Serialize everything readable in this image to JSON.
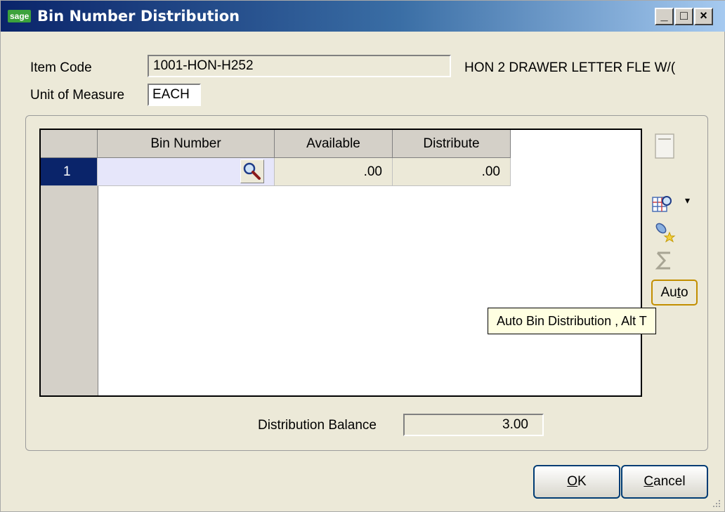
{
  "window": {
    "logo_text": "sage",
    "title": "Bin Number Distribution",
    "minimize": "_",
    "maximize": "□",
    "close": "×"
  },
  "header": {
    "item_code_label": "Item Code",
    "item_code_value": "1001-HON-H252",
    "item_description": "HON 2 DRAWER LETTER FLE W/(",
    "uom_label": "Unit of Measure",
    "uom_value": "EACH"
  },
  "grid": {
    "columns": [
      "Bin Number",
      "Available",
      "Distribute"
    ],
    "rows": [
      {
        "row_number": "1",
        "bin_number": "",
        "available": ".00",
        "distribute": ".00"
      }
    ]
  },
  "side_toolbar": {
    "icons": [
      "blank-note-icon",
      "grid-zoom-icon",
      "lookup-star-icon",
      "sum-icon"
    ],
    "dropdown_arrow": "▾",
    "auto_label": "Auto",
    "tooltip": "Auto Bin Distribution , Alt T"
  },
  "footer": {
    "balance_label": "Distribution Balance",
    "balance_value": "3.00",
    "ok_label": "OK",
    "cancel_label": "Cancel"
  }
}
